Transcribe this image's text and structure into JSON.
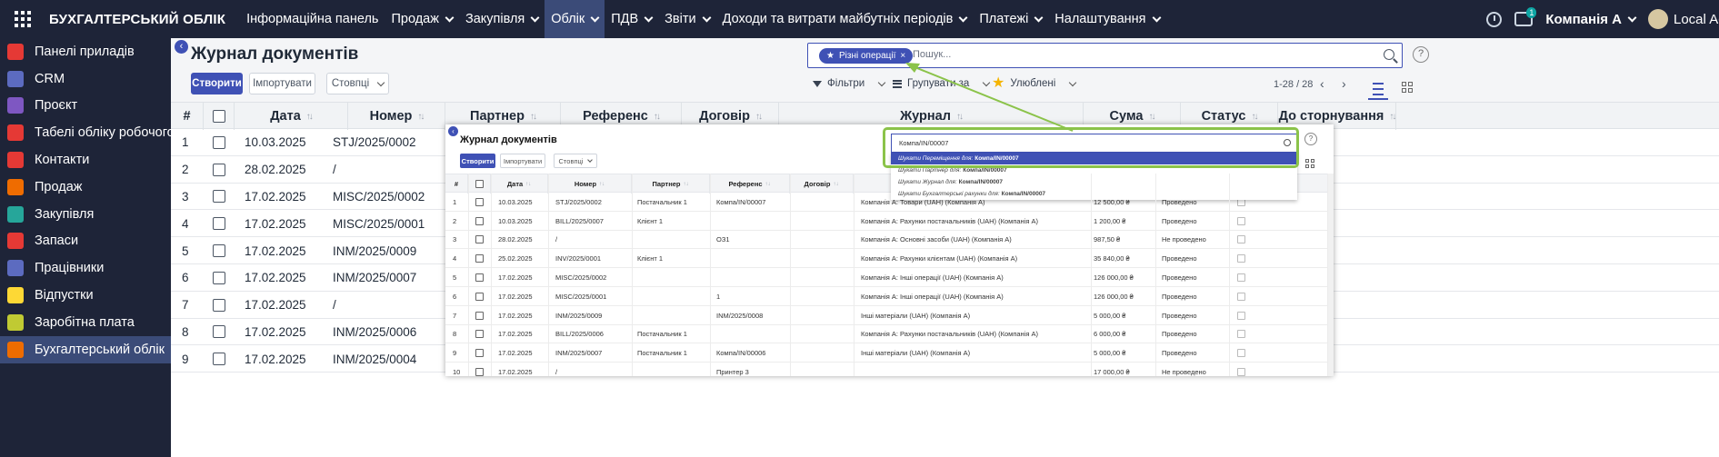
{
  "topbar": {
    "brand": "БУХГАЛТЕРСЬКИЙ ОБЛІК",
    "menu": [
      {
        "label": "Інформаційна панель",
        "caret": false,
        "active": false
      },
      {
        "label": "Продаж",
        "caret": true,
        "active": false
      },
      {
        "label": "Закупівля",
        "caret": true,
        "active": false
      },
      {
        "label": "Облік",
        "caret": true,
        "active": true
      },
      {
        "label": "ПДВ",
        "caret": true,
        "active": false
      },
      {
        "label": "Звіти",
        "caret": true,
        "active": false
      },
      {
        "label": "Доходи та витрати майбутніх періодів",
        "caret": true,
        "active": false
      },
      {
        "label": "Платежі",
        "caret": true,
        "active": false
      },
      {
        "label": "Налаштування",
        "caret": true,
        "active": false
      }
    ],
    "chat_badge": "1",
    "company": "Компанія А",
    "user": "Local Admin"
  },
  "sidebar": {
    "items": [
      {
        "label": "Панелі приладів",
        "color": "#e53935"
      },
      {
        "label": "CRM",
        "color": "#5c6bc0"
      },
      {
        "label": "Проєкт",
        "color": "#7e57c2"
      },
      {
        "label": "Табелі обліку робочого часу",
        "color": "#e53935"
      },
      {
        "label": "Контакти",
        "color": "#e53935"
      },
      {
        "label": "Продаж",
        "color": "#ef6c00"
      },
      {
        "label": "Закупівля",
        "color": "#26a69a"
      },
      {
        "label": "Запаси",
        "color": "#e53935"
      },
      {
        "label": "Працівники",
        "color": "#5c6bc0"
      },
      {
        "label": "Відпустки",
        "color": "#fdd835"
      },
      {
        "label": "Заробітна плата",
        "color": "#c0ca33"
      },
      {
        "label": "Бухгалтерський облік",
        "color": "#ef6c00",
        "active": true
      }
    ]
  },
  "page": {
    "title": "Журнал документів",
    "create_label": "Створити",
    "import_label": "Імпортувати",
    "columns_label": "Стовпці",
    "facet_label": "Різні операції",
    "search_placeholder": "Пошук...",
    "filters_label": "Фільтри",
    "group_label": "Групувати за",
    "favorites_label": "Улюблені",
    "pager": "1-28 / 28",
    "help": "?"
  },
  "table": {
    "headers": [
      "#",
      "Дата",
      "Номер",
      "Партнер",
      "Референс",
      "Договір",
      "Журнал",
      "Сума",
      "Статус",
      "До сторнування"
    ],
    "rows": [
      {
        "n": "1",
        "date": "10.03.2025",
        "num": "STJ/2025/0002"
      },
      {
        "n": "2",
        "date": "28.02.2025",
        "num": "/"
      },
      {
        "n": "3",
        "date": "17.02.2025",
        "num": "MISC/2025/0002"
      },
      {
        "n": "4",
        "date": "17.02.2025",
        "num": "MISC/2025/0001"
      },
      {
        "n": "5",
        "date": "17.02.2025",
        "num": "INM/2025/0009"
      },
      {
        "n": "6",
        "date": "17.02.2025",
        "num": "INM/2025/0007"
      },
      {
        "n": "7",
        "date": "17.02.2025",
        "num": "/"
      },
      {
        "n": "8",
        "date": "17.02.2025",
        "num": "INM/2025/0006"
      },
      {
        "n": "9",
        "date": "17.02.2025",
        "num": "INM/2025/0004"
      }
    ]
  },
  "overlay": {
    "title": "Журнал документів",
    "create_label": "Створити",
    "import_label": "Імпортувати",
    "columns_label": "Стовпці",
    "search_value": "Компа/IN/00007",
    "dropdown": [
      {
        "prefix": "Шукати Переміщення для: ",
        "value": "Компа/IN/00007",
        "active": true
      },
      {
        "prefix": "Шукати Партнер для: ",
        "value": "Компа/IN/00007",
        "active": false
      },
      {
        "prefix": "Шукати Журнал для: ",
        "value": "Компа/IN/00007",
        "active": false
      },
      {
        "prefix": "Шукати Бухгалтерські рахунки для: ",
        "value": "Компа/IN/00007",
        "active": false
      }
    ],
    "headers": [
      "#",
      "Дата",
      "Номер",
      "Партнер",
      "Референс",
      "Договір"
    ],
    "rows": [
      {
        "n": "1",
        "date": "10.03.2025",
        "num": "STJ/2025/0002",
        "partner": "Постачальник 1",
        "ref": "Компа/IN/00007",
        "journal": "Компанія А: Товари (UAH) (Компанія А)",
        "sum": "12 500,00 ₴",
        "status": "Проведено"
      },
      {
        "n": "2",
        "date": "10.03.2025",
        "num": "BILL/2025/0007",
        "partner": "Клієнт 1",
        "ref": "",
        "journal": "Компанія А: Рахунки постачальників (UAH) (Компанія А)",
        "sum": "1 200,00 ₴",
        "status": "Проведено"
      },
      {
        "n": "3",
        "date": "28.02.2025",
        "num": "/",
        "partner": "",
        "ref": "ОЗ1",
        "journal": "Компанія А: Основні засоби (UAH) (Компанія А)",
        "sum": "987,50 ₴",
        "status": "Не проведено"
      },
      {
        "n": "4",
        "date": "25.02.2025",
        "num": "INV/2025/0001",
        "partner": "Клієнт 1",
        "ref": "",
        "journal": "Компанія А: Рахунки клієнтам (UAH) (Компанія А)",
        "sum": "35 840,00 ₴",
        "status": "Проведено"
      },
      {
        "n": "5",
        "date": "17.02.2025",
        "num": "MISC/2025/0002",
        "partner": "",
        "ref": "",
        "journal": "Компанія А: Інші операції (UAH) (Компанія А)",
        "sum": "126 000,00 ₴",
        "status": "Проведено"
      },
      {
        "n": "6",
        "date": "17.02.2025",
        "num": "MISC/2025/0001",
        "partner": "",
        "ref": "1",
        "journal": "Компанія А: Інші операції (UAH) (Компанія А)",
        "sum": "126 000,00 ₴",
        "status": "Проведено"
      },
      {
        "n": "7",
        "date": "17.02.2025",
        "num": "INM/2025/0009",
        "partner": "",
        "ref": "INM/2025/0008",
        "journal": "Інші матеріали (UAH) (Компанія А)",
        "sum": "5 000,00 ₴",
        "status": "Проведено"
      },
      {
        "n": "8",
        "date": "17.02.2025",
        "num": "BILL/2025/0006",
        "partner": "Постачальник 1",
        "ref": "",
        "journal": "Компанія А: Рахунки постачальників (UAH) (Компанія А)",
        "sum": "6 000,00 ₴",
        "status": "Проведено"
      },
      {
        "n": "9",
        "date": "17.02.2025",
        "num": "INM/2025/0007",
        "partner": "Постачальник 1",
        "ref": "Компа/IN/00006",
        "journal": "Інші матеріали (UAH) (Компанія А)",
        "sum": "5 000,00 ₴",
        "status": "Проведено"
      },
      {
        "n": "10",
        "date": "17.02.2025",
        "num": "/",
        "partner": "",
        "ref": "Принтер 3",
        "journal": "",
        "sum": "17 000,00 ₴",
        "status": "Не проведено"
      }
    ]
  }
}
